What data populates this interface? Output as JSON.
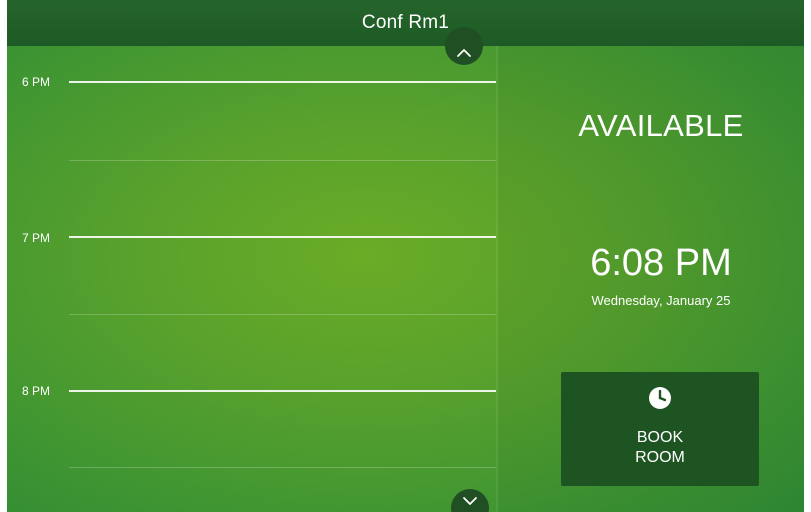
{
  "header": {
    "title": "Conf Rm1"
  },
  "schedule": {
    "hours": [
      {
        "label": "6 PM"
      },
      {
        "label": "7 PM"
      },
      {
        "label": "8 PM"
      }
    ],
    "scroll_up_icon": "chevron-up-icon",
    "scroll_down_icon": "chevron-down-icon"
  },
  "status": {
    "text": "AVAILABLE"
  },
  "clock": {
    "time": "6:08 PM",
    "date": "Wednesday, January 25"
  },
  "book_button": {
    "icon": "clock-icon",
    "label_line1": "BOOK",
    "label_line2": "ROOM"
  },
  "colors": {
    "background_center": "#6aac26",
    "background_edge": "#2f8a34",
    "header": "#1e5a25",
    "button": "#1e5322",
    "text": "#ffffff"
  }
}
